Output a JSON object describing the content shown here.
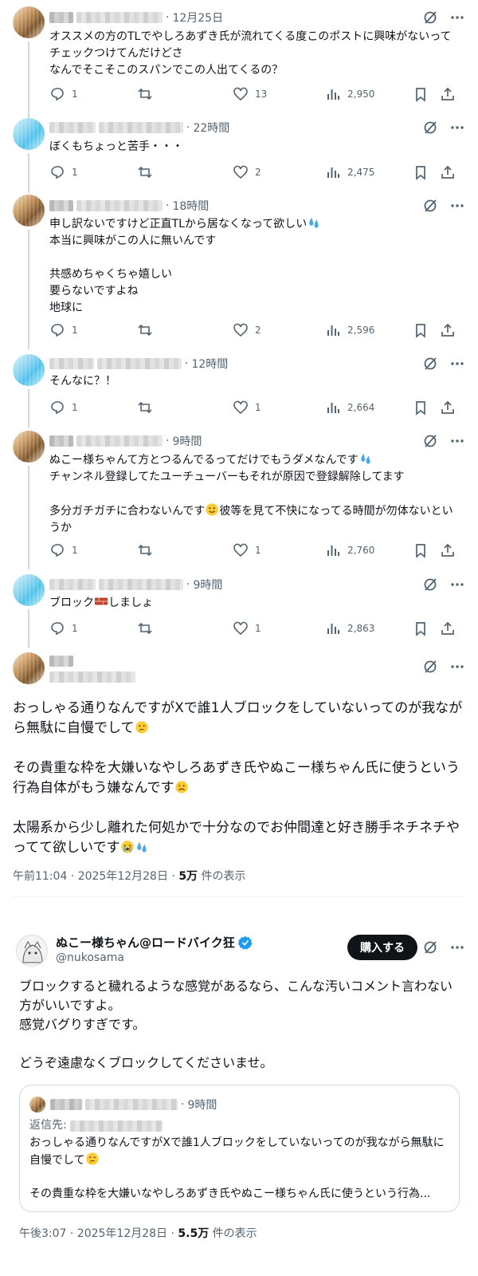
{
  "replies": [
    {
      "time": "12月25日",
      "text": "オススメの方のTLでやしろあずき氏が流れてくる度このポストに興味がないってチェックつけてんだけどさ\nなんでそこそこのスパンでこの人出てくるの？",
      "reply": "1",
      "like": "13",
      "views": "2,950"
    },
    {
      "time": "22時間",
      "text": "ぼくもちょっと苦手・・・",
      "reply": "1",
      "like": "2",
      "views": "2,475"
    },
    {
      "time": "18時間",
      "text_a": "申し訳ないですけど正直TLから居なくなって欲しい",
      "text_b": "本当に興味がこの人に無いんです\n\n共感めちゃくちゃ嬉しい\n要らないですよね\n地球に",
      "reply": "1",
      "like": "2",
      "views": "2,596"
    },
    {
      "time": "12時間",
      "text": "そんなに？！",
      "reply": "1",
      "like": "1",
      "views": "2,664"
    },
    {
      "time": "9時間",
      "text_a": "ぬこー様ちゃんて方とつるんでるってだけでもうダメなんです",
      "text_b": "チャンネル登録してたユーチューバーもそれが原因で登録解除してます\n\n多分ガチガチに合わないんです",
      "text_c": "彼等を見て不快になってる時間が勿体ないというか",
      "reply": "1",
      "like": "1",
      "views": "2,760"
    },
    {
      "time": "9時間",
      "text_a": "ブロック",
      "text_b": "しましょ",
      "reply": "1",
      "like": "1",
      "views": "2,863"
    }
  ],
  "main": {
    "p1": "おっしゃる通りなんですがXで誰1人ブロックをしていないってのが我ながら無駄に自慢でして",
    "p2": "その貴重な枠を大嫌いなやしろあずき氏やぬこー様ちゃん氏に使うという行為自体がもう嫌なんです",
    "p3": "太陽系から少し離れた何処かで十分なのでお仲間達と好き勝手ネチネチやってて欲しいです",
    "time": "午前11:04 · 2025年12月28日 · ",
    "views": "5万",
    "views_suffix": " 件の表示"
  },
  "reply_post": {
    "name": "ぬこー様ちゃん@ロードバイク狂",
    "handle": "@nukosama",
    "buy_label": "購入する",
    "text": "ブロックすると穢れるような感覚があるなら、こんな汚いコメント言わない方がいいですよ。\n感覚バグりすぎです。\n\nどうぞ遠慮なくブロックしてくださいませ。",
    "quote_time": "9時間",
    "quote_reply_label": "返信先: ",
    "quote_text_a": "おっしゃる通りなんですがXで誰1人ブロックをしていないってのが我ながら無駄に自慢でして",
    "quote_text_b": "その貴重な枠を大嫌いなやしろあずき氏やぬこー様ちゃん氏に使うという行為...",
    "time": "午後3:07 · 2025年12月28日 · ",
    "views": "5.5万",
    "views_suffix": " 件の表示"
  },
  "icons": [
    "grok-icon",
    "more-icon",
    "reply-icon",
    "retweet-icon",
    "like-icon",
    "views-icon",
    "bookmark-icon",
    "share-icon",
    "verified-icon",
    "thinking-emoji",
    "sweat-emoji",
    "smile-emoji",
    "sad-emoji",
    "crying-emoji",
    "brick-emoji"
  ],
  "colors": {
    "text": "#0f1419",
    "muted": "#536471",
    "verified": "#1d9bf0",
    "line": "#cfd9de"
  }
}
